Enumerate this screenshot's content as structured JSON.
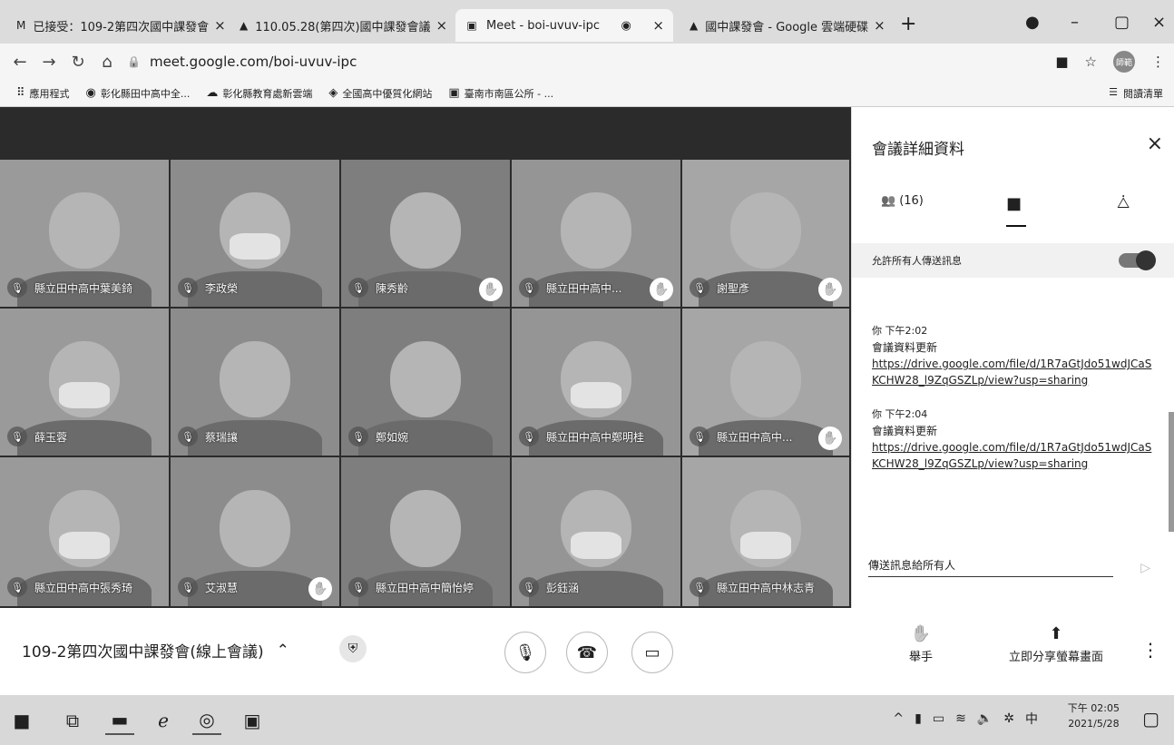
{
  "browser": {
    "tabs": [
      {
        "icon": "M",
        "label": "已接受：109-2第四次國中課發會"
      },
      {
        "icon": "▲",
        "label": "110.05.28(第四次)國中課發會議"
      },
      {
        "icon": "▣",
        "label": "Meet - boi-uvuv-ipc"
      },
      {
        "icon": "▲",
        "label": "國中課發會 - Google 雲端硬碟"
      }
    ],
    "close_glyph": "×",
    "new_tab_glyph": "+",
    "url": "meet.google.com/boi-uvuv-ipc",
    "profile_label": "師範"
  },
  "bookmarks": {
    "items": [
      {
        "icon": "⠿",
        "label": "應用程式"
      },
      {
        "icon": "◉",
        "label": "彰化縣田中高中全..."
      },
      {
        "icon": "☁",
        "label": "彰化縣教育處新雲端"
      },
      {
        "icon": "◈",
        "label": "全國高中優質化網站"
      },
      {
        "icon": "▣",
        "label": "臺南市南區公所 - ..."
      }
    ],
    "reading_list": "閱讀清單"
  },
  "meet": {
    "participants": [
      {
        "name": "縣立田中高中葉美錡",
        "hand": false,
        "mask": false
      },
      {
        "name": "李政榮",
        "hand": false,
        "mask": true
      },
      {
        "name": "陳秀齡",
        "hand": true,
        "mask": false
      },
      {
        "name": "縣立田中高中...",
        "hand": true,
        "mask": false
      },
      {
        "name": "謝聖彥",
        "hand": true,
        "mask": false
      },
      {
        "name": "薛玉蓉",
        "hand": false,
        "mask": true
      },
      {
        "name": "蔡瑞讓",
        "hand": false,
        "mask": false
      },
      {
        "name": "鄭如婉",
        "hand": false,
        "mask": false
      },
      {
        "name": "縣立田中高中鄭明桂",
        "hand": false,
        "mask": true
      },
      {
        "name": "縣立田中高中...",
        "hand": true,
        "mask": false
      },
      {
        "name": "縣立田中高中張秀琦",
        "hand": false,
        "mask": true
      },
      {
        "name": "艾淑慧",
        "hand": true,
        "mask": false
      },
      {
        "name": "縣立田中高中簡怡婷",
        "hand": false,
        "mask": false
      },
      {
        "name": "彭鈺涵",
        "hand": false,
        "mask": true
      },
      {
        "name": "縣立田中高中林志青",
        "hand": false,
        "mask": true
      }
    ],
    "hand_glyph": "✋",
    "mic_off_glyph": "🎙"
  },
  "panel": {
    "title": "會議詳細資料",
    "close_glyph": "×",
    "people_count": "(16)",
    "allow_label": "允許所有人傳送訊息",
    "messages": [
      {
        "sender": "你",
        "time": "下午2:02",
        "text": "會議資料更新",
        "link": "https://drive.google.com/file/d/1R7aGtJdo51wdJCaSKCHW28_l9ZqGSZLp/view?usp=sharing"
      },
      {
        "sender": "你",
        "time": "下午2:04",
        "text": "會議資料更新",
        "link": "https://drive.google.com/file/d/1R7aGtJdo51wdJCaSKCHW28_l9ZqGSZLp/view?usp=sharing"
      }
    ],
    "send_placeholder": "傳送訊息給所有人"
  },
  "bottombar": {
    "meeting_name": "109-2第四次國中課發會(線上會議)",
    "raise_hand": "舉手",
    "present_now": "立即分享螢幕畫面"
  },
  "taskbar": {
    "time": "下午 02:05",
    "date": "2021/5/28",
    "ime": "中"
  }
}
